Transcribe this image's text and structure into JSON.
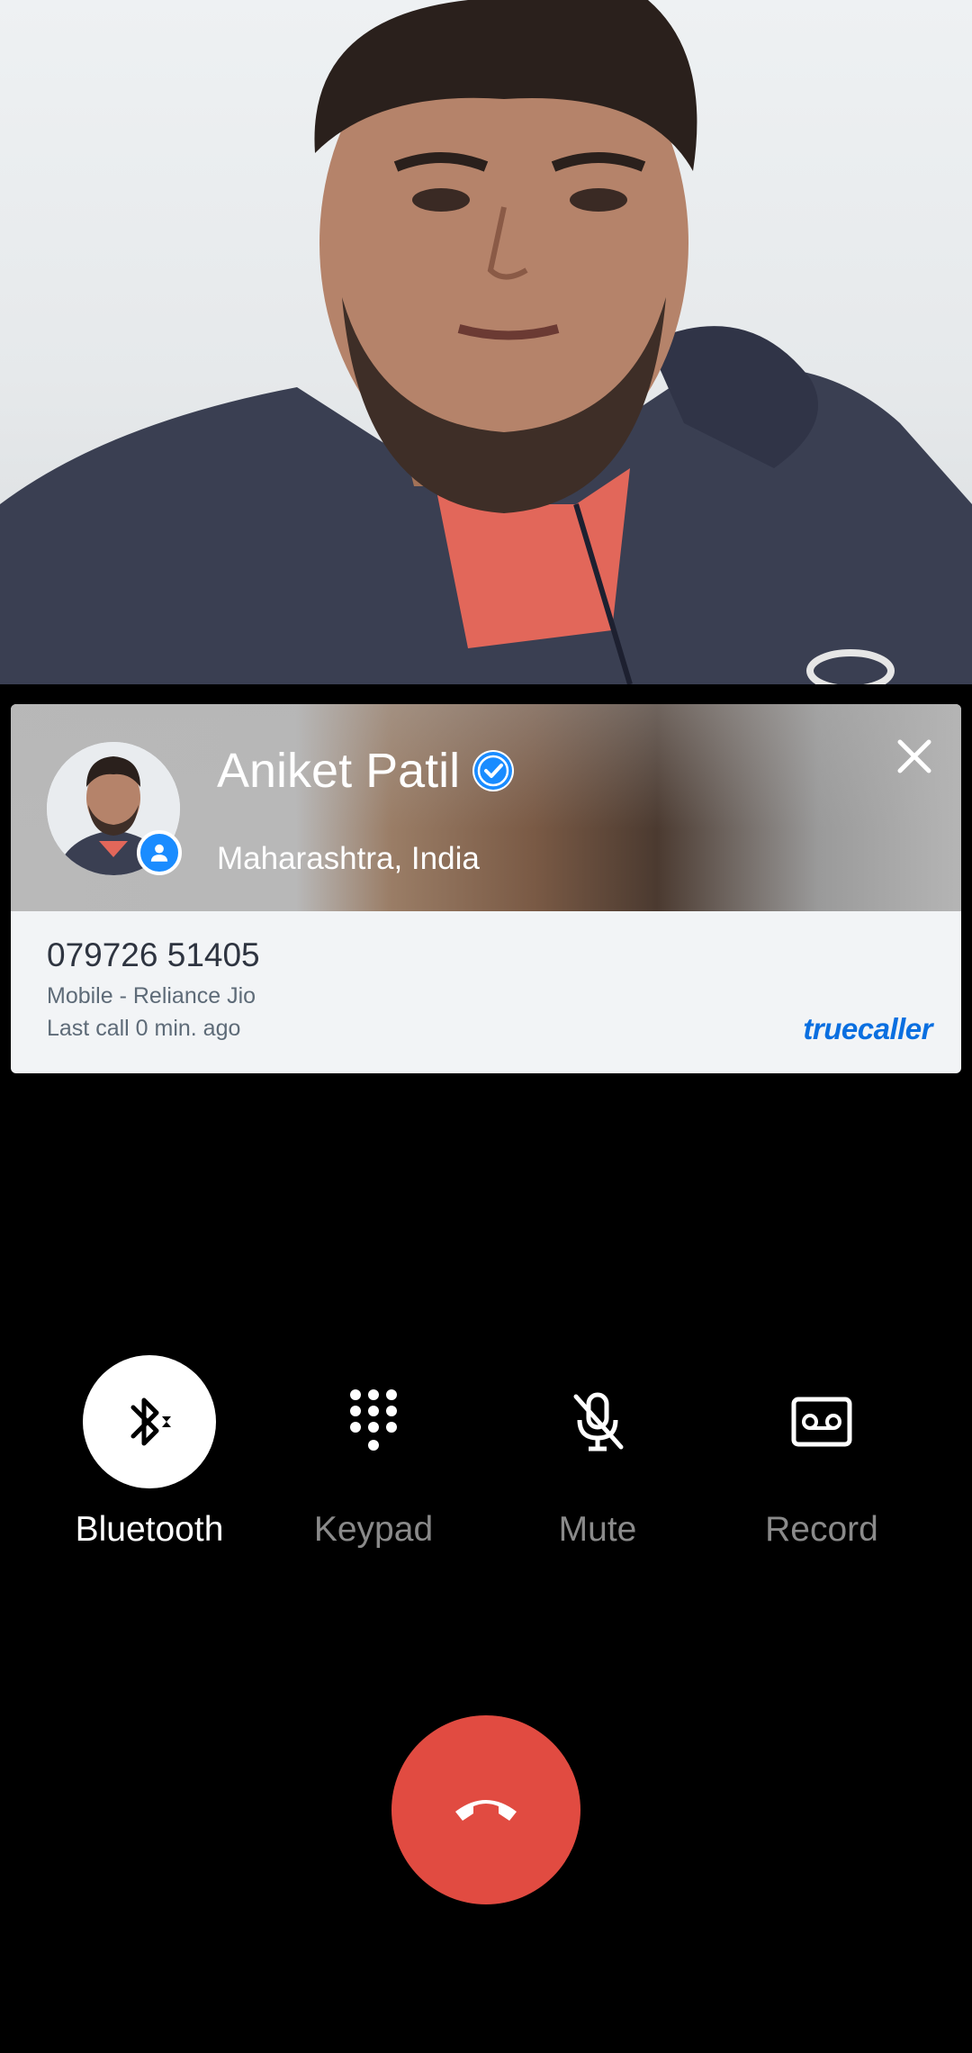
{
  "caller": {
    "name": "Aniket Patil",
    "location": "Maharashtra, India",
    "number": "079726 51405",
    "carrier": "Mobile - Reliance Jio",
    "last_call": "Last call 0 min. ago",
    "verified": true
  },
  "brand": {
    "logo_text": "truecaller",
    "accent": "#0a6fe0"
  },
  "controls": [
    {
      "label": "Bluetooth",
      "icon": "bluetooth-icon",
      "active": true
    },
    {
      "label": "Keypad",
      "icon": "dialpad-icon",
      "active": false
    },
    {
      "label": "Mute",
      "icon": "mic-off-icon",
      "active": false
    },
    {
      "label": "Record",
      "icon": "record-icon",
      "active": false
    }
  ],
  "end_call": {
    "icon": "end-call-icon",
    "color": "#e14b41"
  }
}
